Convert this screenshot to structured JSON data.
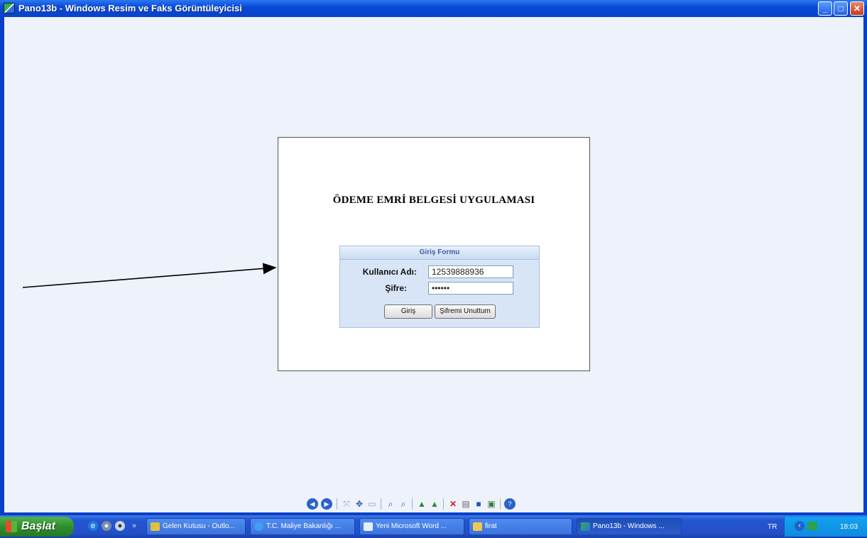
{
  "window": {
    "title": "Pano13b - Windows Resim ve Faks Görüntüleyicisi",
    "buttons": {
      "minimize": "_",
      "maximize": "□",
      "close": "✕"
    }
  },
  "document": {
    "heading": "ÖDEME EMRİ BELGESİ UYGULAMASI",
    "form": {
      "header": "Giriş Formu",
      "username_label": "Kullanıcı Adı:",
      "username_value": "12539888936",
      "password_label": "Şifre:",
      "password_value": "••••••",
      "login_button": "Giriş",
      "forgot_button": "Şifremi Unuttum"
    }
  },
  "viewer_toolbar": {
    "icons": [
      "previous-image-icon",
      "next-image-icon",
      "best-fit-icon",
      "actual-size-icon",
      "slideshow-icon",
      "zoom-in-icon",
      "zoom-out-icon",
      "rotate-clockwise-icon",
      "rotate-counterclockwise-icon",
      "delete-icon",
      "print-icon",
      "save-icon",
      "open-editor-icon",
      "help-icon"
    ]
  },
  "taskbar": {
    "start_label": "Başlat",
    "tasks": [
      {
        "label": "Gelen Kutusu - Outlo..."
      },
      {
        "label": "T.C. Maliye Bakanlığı ..."
      },
      {
        "label": "Yeni Microsoft Word ..."
      },
      {
        "label": "firat"
      },
      {
        "label": "Pano13b - Windows ..."
      }
    ],
    "tray": {
      "language": "TR",
      "clock": "18:03"
    },
    "colors": {
      "start_green": "#2f8f2f",
      "taskbar_blue": "#2456d2"
    }
  }
}
